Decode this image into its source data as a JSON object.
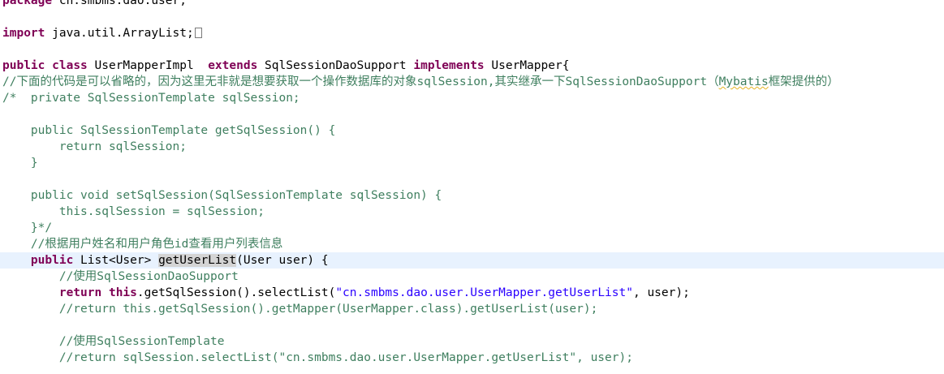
{
  "editor": {
    "current_line_color": "#e8f2fe",
    "colors": {
      "keyword": "#7f0055",
      "comment": "#3f7f5f",
      "string": "#2a00ff",
      "default": "#000000"
    },
    "lines": [
      {
        "segments": [
          {
            "t": "package",
            "c": "kw"
          },
          {
            "t": " cn.smbms.dao.user;",
            "c": "plain"
          }
        ]
      },
      {
        "segments": []
      },
      {
        "segments": [
          {
            "t": "import",
            "c": "kw"
          },
          {
            "t": " java.util.ArrayList;",
            "c": "plain"
          }
        ],
        "fold_box": true
      },
      {
        "segments": []
      },
      {
        "segments": [
          {
            "t": "public",
            "c": "kw"
          },
          {
            "t": " ",
            "c": "plain"
          },
          {
            "t": "class",
            "c": "kw"
          },
          {
            "t": " UserMapperImpl  ",
            "c": "plain"
          },
          {
            "t": "extends",
            "c": "kw"
          },
          {
            "t": " SqlSessionDaoSupport ",
            "c": "plain"
          },
          {
            "t": "implements",
            "c": "kw"
          },
          {
            "t": " UserMapper{",
            "c": "plain"
          }
        ]
      },
      {
        "segments": [
          {
            "t": "//下面的代码是可以省略的，因为这里无非就是想要获取一个操作数据库的对象sqlSession,其实继承一下SqlSessionDaoSupport（",
            "c": "cm"
          },
          {
            "t": "Mybatis",
            "c": "cm",
            "warn": true
          },
          {
            "t": "框架提供的）",
            "c": "cm"
          }
        ]
      },
      {
        "segments": [
          {
            "t": "/*  private SqlSessionTemplate sqlSession;",
            "c": "cm"
          }
        ]
      },
      {
        "segments": []
      },
      {
        "segments": [
          {
            "t": "    public SqlSessionTemplate getSqlSession() {",
            "c": "cm"
          }
        ]
      },
      {
        "segments": [
          {
            "t": "        return sqlSession;",
            "c": "cm"
          }
        ]
      },
      {
        "segments": [
          {
            "t": "    }",
            "c": "cm"
          }
        ]
      },
      {
        "segments": []
      },
      {
        "segments": [
          {
            "t": "    public void setSqlSession(SqlSessionTemplate sqlSession) {",
            "c": "cm"
          }
        ]
      },
      {
        "segments": [
          {
            "t": "        this.sqlSession = sqlSession;",
            "c": "cm"
          }
        ]
      },
      {
        "segments": [
          {
            "t": "    }*/",
            "c": "cm"
          }
        ]
      },
      {
        "segments": [
          {
            "t": "    //根据用户姓名和用户角色id查看用户列表信息",
            "c": "cm"
          }
        ]
      },
      {
        "current": true,
        "segments": [
          {
            "t": "    ",
            "c": "plain"
          },
          {
            "t": "public",
            "c": "kw"
          },
          {
            "t": " List<User> ",
            "c": "plain"
          },
          {
            "t": "getUserList",
            "c": "plain",
            "mark": true
          },
          {
            "t": "(User user) {",
            "c": "plain"
          }
        ]
      },
      {
        "segments": [
          {
            "t": "        //使用SqlSessionDaoSupport",
            "c": "cm"
          }
        ]
      },
      {
        "segments": [
          {
            "t": "        ",
            "c": "plain"
          },
          {
            "t": "return",
            "c": "kw"
          },
          {
            "t": " ",
            "c": "plain"
          },
          {
            "t": "this",
            "c": "kw"
          },
          {
            "t": ".getSqlSession().selectList(",
            "c": "plain"
          },
          {
            "t": "\"cn.smbms.dao.user.UserMapper.getUserList\"",
            "c": "str"
          },
          {
            "t": ", user);",
            "c": "plain"
          }
        ]
      },
      {
        "segments": [
          {
            "t": "        //return this.getSqlSession().getMapper(UserMapper.class).getUserList(user);",
            "c": "cm"
          }
        ]
      },
      {
        "segments": []
      },
      {
        "segments": [
          {
            "t": "        //使用SqlSessionTemplate",
            "c": "cm"
          }
        ]
      },
      {
        "segments": [
          {
            "t": "        //return sqlSession.selectList(\"cn.smbms.dao.user.UserMapper.getUserList\", user);",
            "c": "cm"
          }
        ]
      }
    ]
  }
}
